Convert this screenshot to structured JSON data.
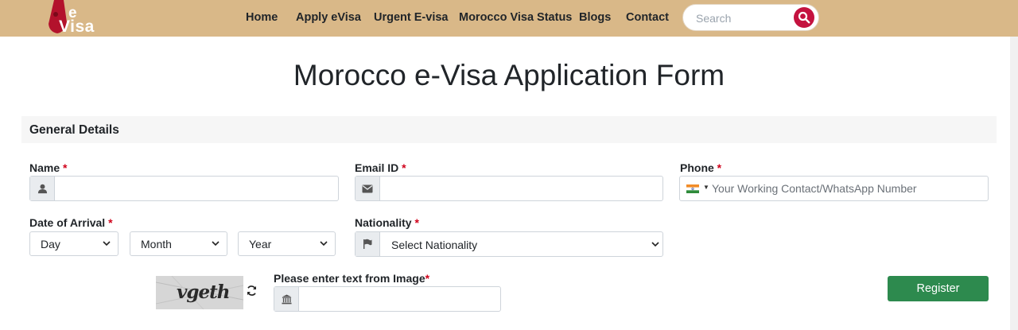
{
  "header": {
    "logo": {
      "e": "e",
      "visa": "Visa"
    },
    "nav": [
      {
        "label": "Home"
      },
      {
        "label": "Apply eVisa"
      },
      {
        "label": "Urgent E-visa"
      },
      {
        "label": "Morocco Visa Status"
      },
      {
        "label": "Blogs"
      },
      {
        "label": "Contact"
      }
    ],
    "search": {
      "placeholder": "Search",
      "icon": "search-icon"
    },
    "colors": {
      "bar": "#d9b888",
      "search_button": "#c4123f"
    }
  },
  "page": {
    "title": "Morocco e-Visa Application Form"
  },
  "section": {
    "title": "General Details"
  },
  "form": {
    "name": {
      "label": "Name",
      "required": "*",
      "icon": "user-icon",
      "value": ""
    },
    "email": {
      "label": "Email ID",
      "required": "*",
      "icon": "envelope-icon",
      "value": ""
    },
    "phone": {
      "label": "Phone",
      "required": "*",
      "placeholder": "Your Working Contact/WhatsApp Number",
      "flag": "india-flag-icon"
    },
    "arrival": {
      "label": "Date of Arrival",
      "required": "*",
      "day": "Day",
      "month": "Month",
      "year": "Year"
    },
    "nationality": {
      "label": "Nationality",
      "required": "*",
      "selected": "Select Nationality",
      "icon": "flag-icon"
    },
    "captcha": {
      "image_text": "vgeth",
      "label": "Please enter text from Image",
      "required": "*",
      "icon": "bank-icon",
      "value": ""
    },
    "register": {
      "label": "Register",
      "color": "#2d8a4e"
    }
  }
}
